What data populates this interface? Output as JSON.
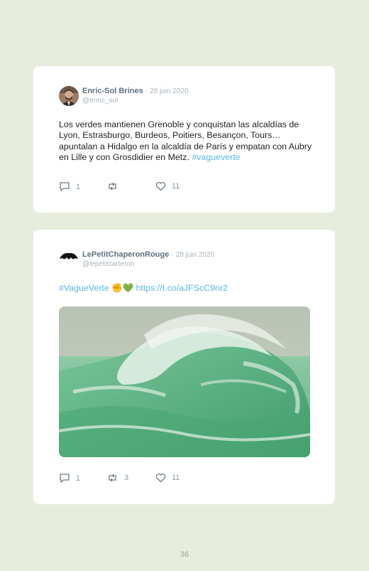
{
  "tweets": [
    {
      "author": "Enric-Sol Brines",
      "separator": "·",
      "date": "28 juin 2020",
      "handle": "@enric_sol",
      "text": "Los verdes mantienen Grenoble y conquistan las alcaldías de Lyon, Estrasburgo, Burdeos, Poitiers, Besançon, Tours… apuntalan a Hidalgo en la alcaldía de París y empatan con Aubry en Lille y con Grosdidier en Metz.",
      "hashtag": "#vagueverte",
      "replies": "1",
      "retweets": "",
      "likes": "11",
      "avatar_icon": "person-photo"
    },
    {
      "author": "LePetitChaperonRouge",
      "separator": "·",
      "date": "28 juin 2020",
      "handle": "@lepetitcarteron",
      "hashtag": "#VagueVerte",
      "emojis": "✊💚",
      "url": "https://t.co/aJFScC9nr2",
      "replies": "1",
      "retweets": "3",
      "likes": "11",
      "avatar_icon": "hat-silhouette",
      "media_icon": "green-wave-painting"
    }
  ],
  "page_number": "36",
  "colors": {
    "background": "#e7eddd",
    "card": "#ffffff",
    "link": "#59b6e6",
    "author": "#5d7080",
    "meta": "#a9b4bd"
  }
}
